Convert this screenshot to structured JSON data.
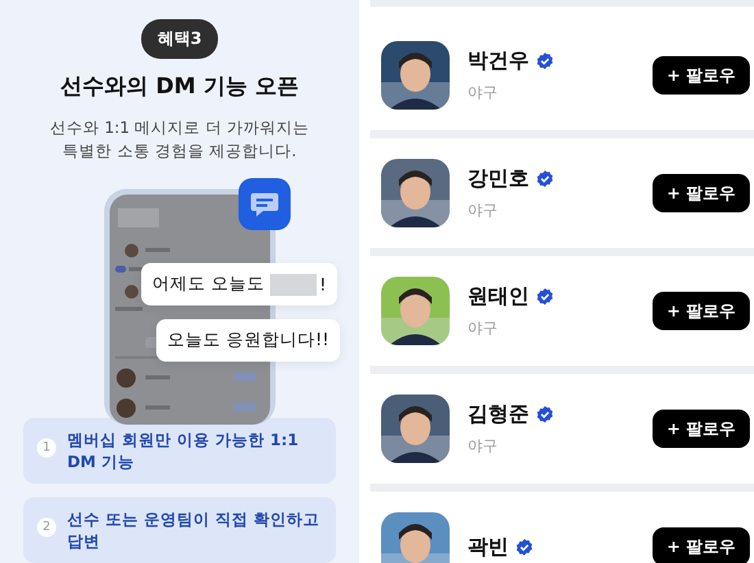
{
  "benefit": {
    "badge": "혜택3",
    "title": "선수와의 DM 기능 오픈",
    "description": "선수와 1:1 메시지로 더 가까워지는\n특별한 소통 경험을 제공합니다.",
    "bubbles": [
      {
        "kind": "redacted",
        "before": "어제도 오늘도",
        "after": "!"
      },
      {
        "kind": "plain",
        "text": "오늘도 응원합니다!!"
      }
    ],
    "features": [
      {
        "number": "1",
        "text": "멤버십 회원만 이용 가능한 1:1 DM 기능"
      },
      {
        "number": "2",
        "text": "선수 또는 운영팀이 직접 확인하고 답변"
      }
    ]
  },
  "players": [
    {
      "name": "박건우",
      "category": "야구",
      "verified": true,
      "button": "+ 팔로우",
      "color": "#2c4a6e"
    },
    {
      "name": "강민호",
      "category": "야구",
      "verified": true,
      "button": "+ 팔로우",
      "color": "#5a6a80"
    },
    {
      "name": "원태인",
      "category": "야구",
      "verified": true,
      "button": "+ 팔로우",
      "color": "#8cc152"
    },
    {
      "name": "김형준",
      "category": "야구",
      "verified": true,
      "button": "+ 팔로우",
      "color": "#4a5e78"
    },
    {
      "name": "곽빈",
      "verified": true,
      "button": "+ 팔로우",
      "color": "#5b8fc0"
    }
  ]
}
